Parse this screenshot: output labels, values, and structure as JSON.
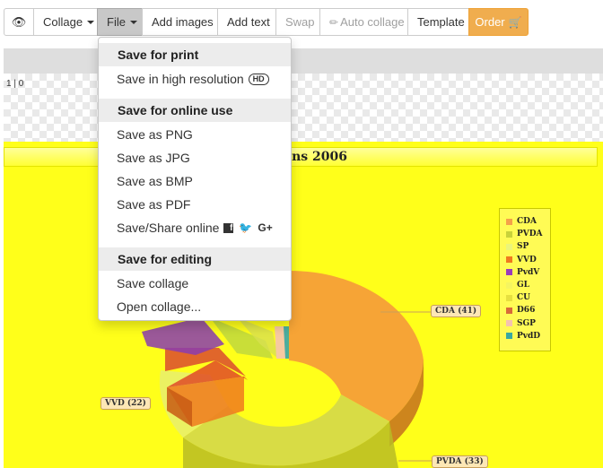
{
  "toolbar": {
    "preview_icon": "eye-icon",
    "collage_label": "Collage",
    "file_label": "File",
    "add_images_label": "Add images",
    "add_text_label": "Add text",
    "swap_label": "Swap",
    "auto_collage_label": "Auto collage",
    "template_label": "Template",
    "order_label": "Order",
    "order_color": "#f0ad4e"
  },
  "canvas": {
    "coords": "1 | 0"
  },
  "file_menu": {
    "print_section": "Save for print",
    "save_high_res": "Save in high resolution",
    "hd_badge": "HD",
    "online_section": "Save for online use",
    "save_png": "Save as PNG",
    "save_jpg": "Save as JPG",
    "save_bmp": "Save as BMP",
    "save_pdf": "Save as PDF",
    "save_share": "Save/Share online",
    "editing_section": "Save for editing",
    "save_collage": "Save collage",
    "open_collage": "Open collage..."
  },
  "image_content": {
    "title_fragment": "tions 2006",
    "legend": [
      {
        "label": "CDA",
        "color": "#f5a14a"
      },
      {
        "label": "PVDA",
        "color": "#c9d23a"
      },
      {
        "label": "SP",
        "color": "#ecf57a"
      },
      {
        "label": "VVD",
        "color": "#f07a1e"
      },
      {
        "label": "PvdV",
        "color": "#9a3cbb"
      },
      {
        "label": "GL",
        "color": "#f5f560"
      },
      {
        "label": "CU",
        "color": "#e6e040"
      },
      {
        "label": "D66",
        "color": "#d86a3a"
      },
      {
        "label": "SGP",
        "color": "#f5c3b0"
      },
      {
        "label": "PvdD",
        "color": "#3aa8a0"
      }
    ],
    "callouts": {
      "cda": "CDA (41)",
      "vvd": "VVD (22)",
      "pvda": "PVDA (33)"
    }
  }
}
